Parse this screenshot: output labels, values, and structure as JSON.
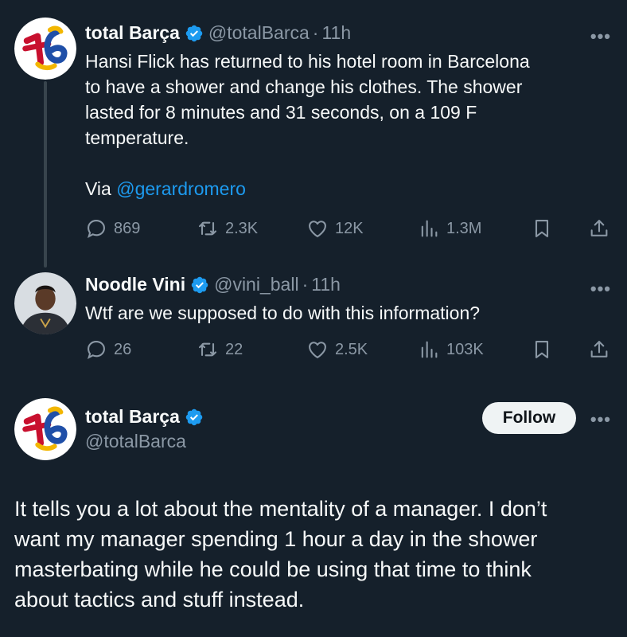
{
  "tweets": [
    {
      "name": "total Barça",
      "handle": "@totalBarca",
      "dot": "·",
      "time": "11h",
      "text_lines": [
        "Hansi Flick has returned to his hotel room in Barcelona",
        "to have a shower and change his clothes. The shower",
        "lasted for 8 minutes and 31 seconds, on a 109 F",
        "temperature."
      ],
      "via_prefix": "Via ",
      "via_mention": "@gerardromero",
      "replies": "869",
      "reposts": "2.3K",
      "likes": "12K",
      "views": "1.3M"
    },
    {
      "name": "Noodle Vini",
      "handle": "@vini_ball",
      "dot": "·",
      "time": "11h",
      "text": "Wtf are we supposed to do with this information?",
      "replies": "26",
      "reposts": "22",
      "likes": "2.5K",
      "views": "103K"
    }
  ],
  "main": {
    "name": "total Barça",
    "handle": "@totalBarca",
    "follow_label": "Follow",
    "text_lines": [
      "It tells you a lot about the mentality of a manager. I don’t",
      "want my manager spending 1 hour a day in the shower",
      "masterbating while he could be using that time to think",
      "about tactics and stuff instead."
    ]
  },
  "more_label": "•••",
  "colors": {
    "background": "#15202b",
    "accent": "#1d9bf0",
    "muted": "#8b98a5",
    "text": "#f7f9f9"
  },
  "icons": [
    "verified-badge-icon",
    "reply-icon",
    "repost-icon",
    "like-icon",
    "views-icon",
    "bookmark-icon",
    "share-icon",
    "more-icon"
  ]
}
